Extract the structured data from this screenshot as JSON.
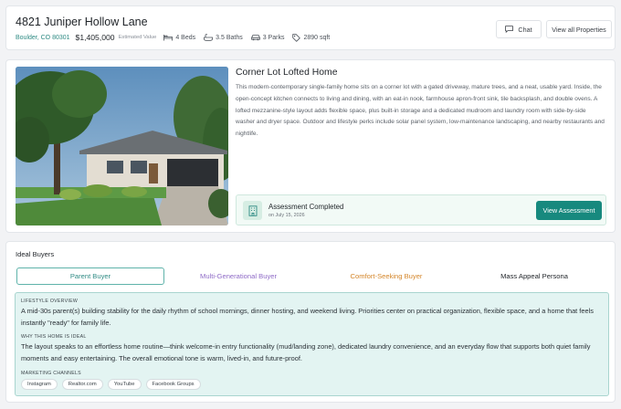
{
  "header": {
    "address": "4821 Juniper Hollow Lane",
    "city": "Boulder, CO 80301",
    "price": "$1,405,000",
    "price_note": "Estimated Value",
    "features": {
      "beds": "4 Beds",
      "baths": "3.5 Baths",
      "parks": "3 Parks",
      "sqft": "2890 sqft"
    },
    "chat_label": "Chat",
    "view_all_label": "View all Properties"
  },
  "property": {
    "name": "Corner Lot Lofted Home",
    "description": "This modern-contemporary single-family home sits on a corner lot with a gated driveway, mature trees, and a neat, usable yard. Inside, the open-concept kitchen connects to living and dining, with an eat-in nook, farmhouse apron-front sink, tile backsplash, and double ovens. A lofted mezzanine-style layout adds flexible space, plus built-in storage and a dedicated mudroom and laundry room with side-by-side washer and dryer space. Outdoor and lifestyle perks include solar panel system, low-maintenance landscaping, and nearby restaurants and nightlife.",
    "assessment": {
      "title": "Assessment Completed",
      "date": "on July 15, 2026",
      "button_label": "View Assessment"
    }
  },
  "buyers": {
    "section_title": "Ideal Buyers",
    "tabs": [
      {
        "label": "Parent Buyer"
      },
      {
        "label": "Multi-Generational Buyer"
      },
      {
        "label": "Comfort-Seeking Buyer"
      },
      {
        "label": "Mass Appeal Persona"
      }
    ],
    "active_tab": 0,
    "persona": {
      "lifestyle_label": "LIFESTYLE OVERVIEW",
      "lifestyle_text": "A mid-30s parent(s) building stability for the daily rhythm of school mornings, dinner hosting, and weekend living. Priorities center on practical organization, flexible space, and a home that feels instantly \"ready\" for family life.",
      "ideal_label": "WHY THIS HOME IS IDEAL",
      "ideal_text": "The layout speaks to an effortless home routine—think welcome-in entry functionality (mud/landing zone), dedicated laundry convenience, and an everyday flow that supports both quiet family moments and easy entertaining. The overall emotional tone is warm, lived-in, and future-proof.",
      "channels_label": "MARKETING CHANNELS",
      "channels": [
        "Instagram",
        "Realtor.com",
        "YouTube",
        "Facebook Groups"
      ]
    }
  },
  "colors": {
    "accent": "#17897e",
    "accent_text": "#2f8b84",
    "persona_bg": "#e3f4f2",
    "tab_purple": "#8f6bc7",
    "tab_orange": "#d4862a"
  }
}
